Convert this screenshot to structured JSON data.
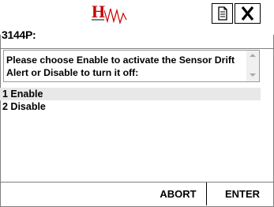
{
  "header": {
    "logo_text": "H",
    "page_title": "3144P:"
  },
  "prompt": {
    "text": "Please choose Enable to activate the Sensor Drift Alert or Disable to turn it off:"
  },
  "options": [
    {
      "label": "1 Enable",
      "selected": true
    },
    {
      "label": "2 Disable",
      "selected": false
    }
  ],
  "footer": {
    "abort_label": "ABORT",
    "enter_label": "ENTER"
  },
  "colors": {
    "logo_red": "#c80000",
    "selected_row_bg": "#e8e8e8"
  },
  "icons": {
    "document": "document-icon",
    "close": "close-icon"
  }
}
